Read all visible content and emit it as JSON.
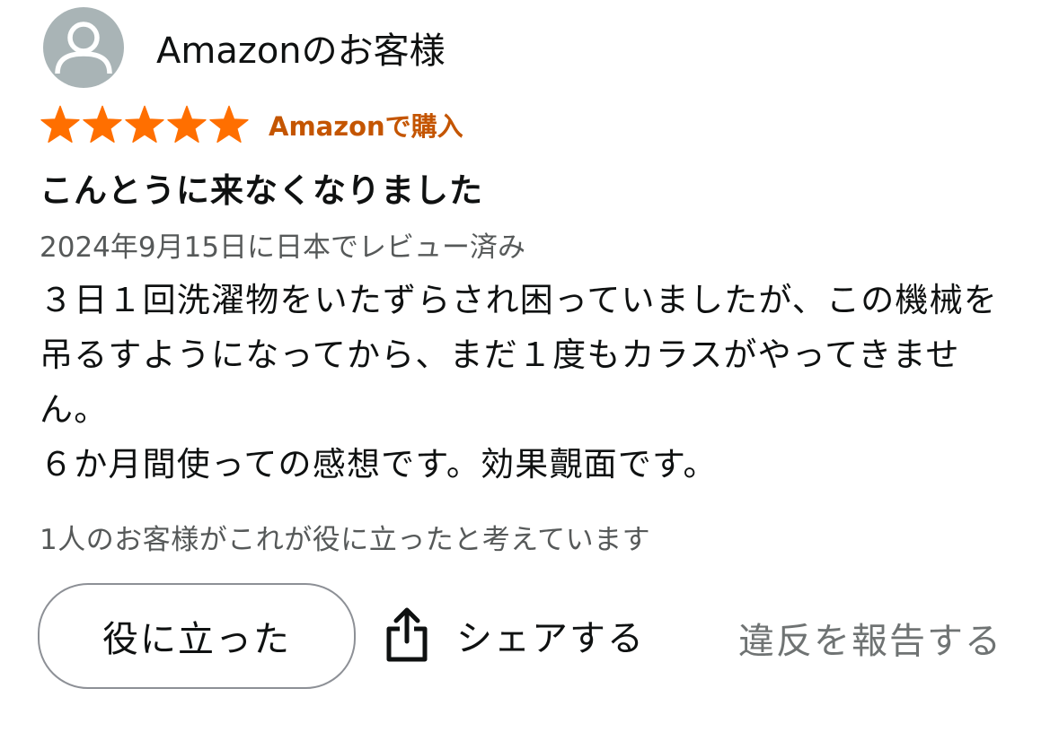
{
  "review": {
    "author_name": "Amazonのお客様",
    "rating": 5,
    "max_rating": 5,
    "verified_label": "Amazonで購入",
    "title": "こんとうに来なくなりました",
    "date_line": "2024年9月15日に日本でレビュー済み",
    "body_lines": [
      "３日１回洗濯物をいたずらされ困っていましたが、この機械を吊るすようになってから、まだ１度もカラスがやってきません。",
      "６か月間使っての感想です。効果覿面です。"
    ],
    "helpful_count_text": "1人のお客様がこれが役に立ったと考えています"
  },
  "actions": {
    "helpful_label": "役に立った",
    "share_label": "シェアする",
    "report_label": "違反を報告する"
  },
  "icons": {
    "avatar": "person-icon",
    "star": "star-icon",
    "share": "share-icon"
  },
  "colors": {
    "star": "#ff6f00",
    "verified": "#c45500",
    "secondary_text": "#565959",
    "avatar_bg": "#a9b4b6"
  }
}
